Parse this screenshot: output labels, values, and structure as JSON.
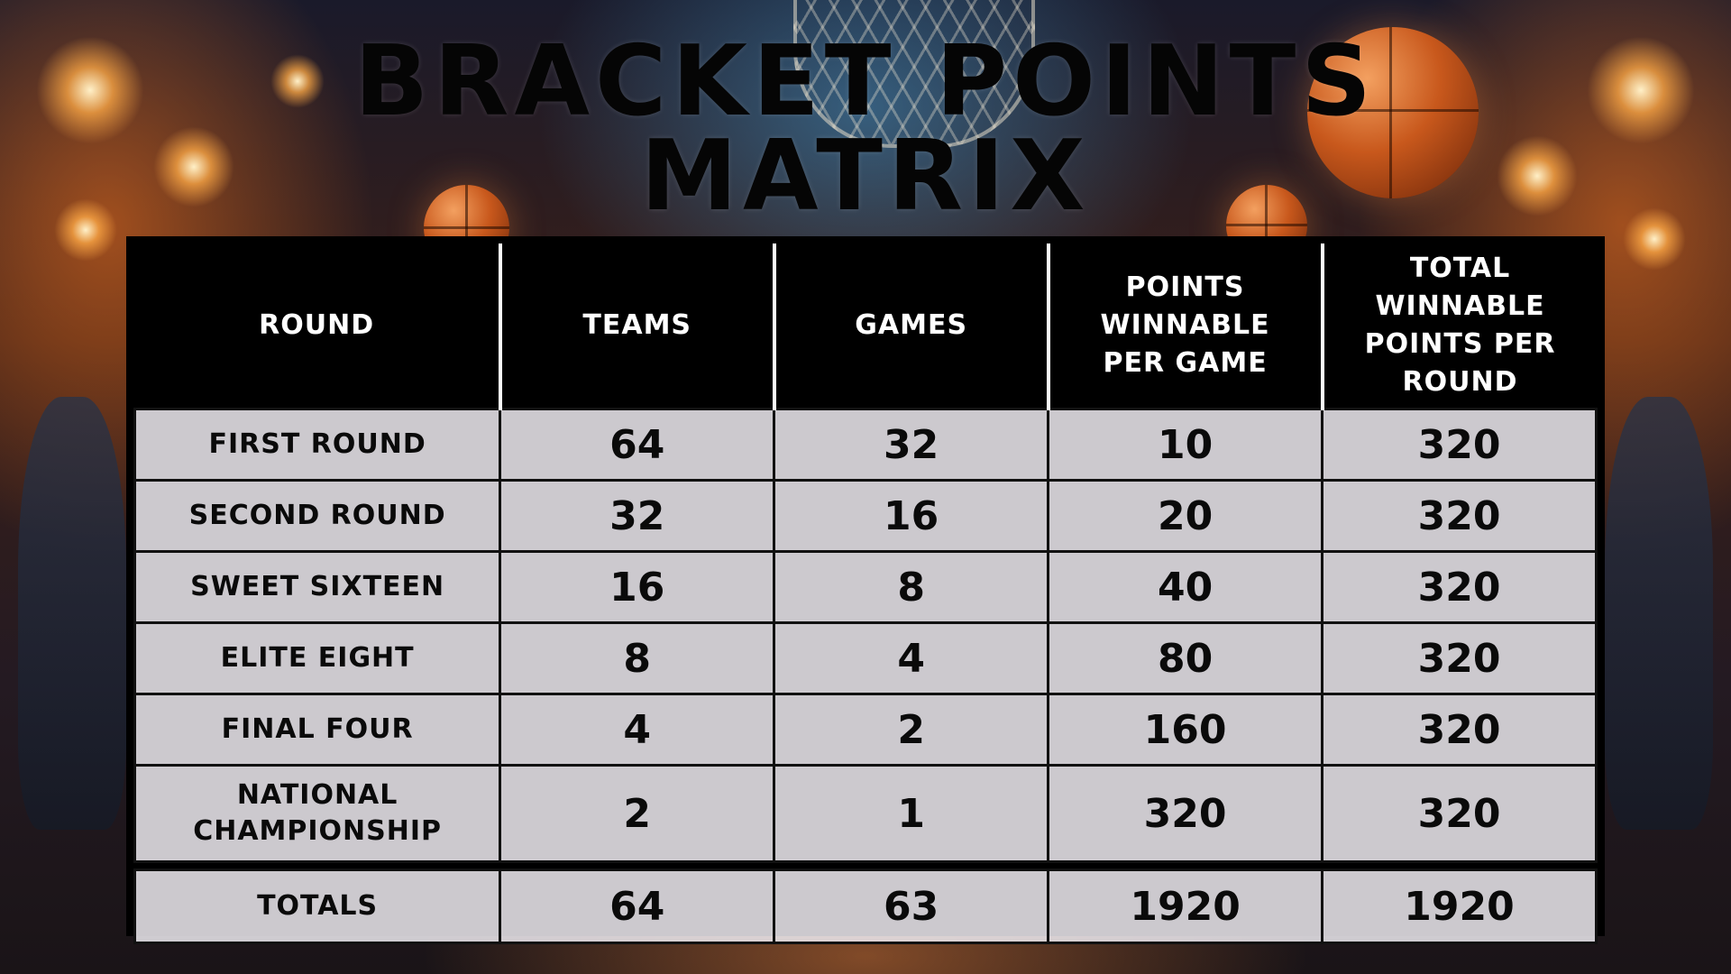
{
  "title": {
    "line1": "BRACKET POINTS",
    "line2": "MATRIX"
  },
  "table": {
    "headers": [
      "ROUND",
      "TEAMS",
      "GAMES",
      "POINTS WINNABLE PER GAME",
      "TOTAL WINNABLE POINTS PER ROUND"
    ],
    "rows": [
      {
        "round": "FIRST ROUND",
        "teams": "64",
        "games": "32",
        "points_per_game": "10",
        "total_points": "320"
      },
      {
        "round": "SECOND ROUND",
        "teams": "32",
        "games": "16",
        "points_per_game": "20",
        "total_points": "320"
      },
      {
        "round": "SWEET SIXTEEN",
        "teams": "16",
        "games": "8",
        "points_per_game": "40",
        "total_points": "320"
      },
      {
        "round": "ELITE EIGHT",
        "teams": "8",
        "games": "4",
        "points_per_game": "80",
        "total_points": "320"
      },
      {
        "round": "FINAL FOUR",
        "teams": "4",
        "games": "2",
        "points_per_game": "160",
        "total_points": "320"
      },
      {
        "round": "NATIONAL CHAMPIONSHIP",
        "teams": "2",
        "games": "1",
        "points_per_game": "320",
        "total_points": "320"
      }
    ],
    "totals": {
      "round": "TOTALS",
      "teams": "64",
      "games": "63",
      "points_per_game": "1920",
      "total_points": "1920"
    }
  }
}
